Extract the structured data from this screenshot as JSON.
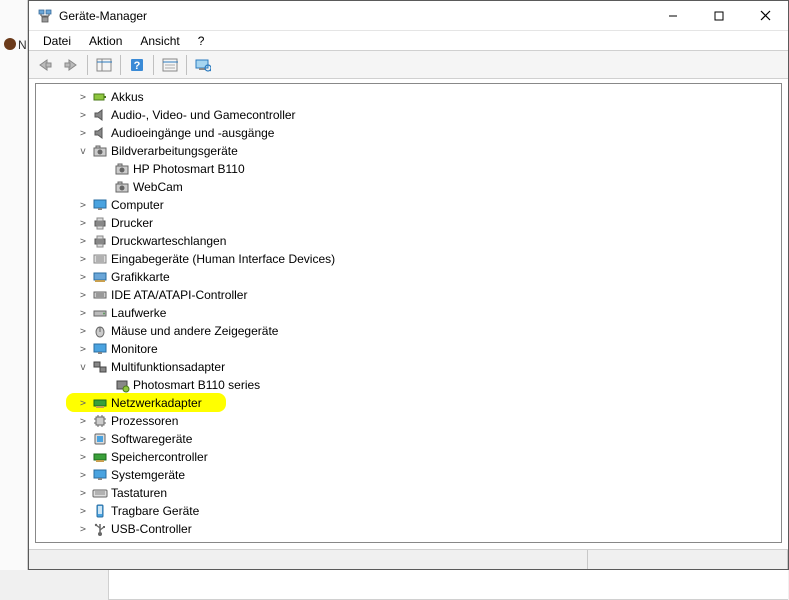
{
  "window": {
    "title": "Geräte-Manager"
  },
  "menu": {
    "file": "Datei",
    "action": "Aktion",
    "view": "Ansicht",
    "help": "?"
  },
  "tree": {
    "akkus": "Akkus",
    "audio": "Audio-, Video- und Gamecontroller",
    "audioio": "Audioeingänge und -ausgänge",
    "imaging": "Bildverarbeitungsgeräte",
    "imaging_children": {
      "hp": "HP Photosmart B110",
      "webcam": "WebCam"
    },
    "computer": "Computer",
    "printer": "Drucker",
    "printqueue": "Druckwarteschlangen",
    "hid": "Eingabegeräte (Human Interface Devices)",
    "graphics": "Grafikkarte",
    "ide": "IDE ATA/ATAPI-Controller",
    "drives": "Laufwerke",
    "mice": "Mäuse und andere Zeigegeräte",
    "monitors": "Monitore",
    "multifunc": "Multifunktionsadapter",
    "multifunc_children": {
      "ps": "Photosmart B110 series"
    },
    "netadapter": "Netzwerkadapter",
    "cpu": "Prozessoren",
    "software": "Softwaregeräte",
    "storage": "Speichercontroller",
    "system": "Systemgeräte",
    "keyboards": "Tastaturen",
    "portable": "Tragbare Geräte",
    "usb": "USB-Controller"
  }
}
